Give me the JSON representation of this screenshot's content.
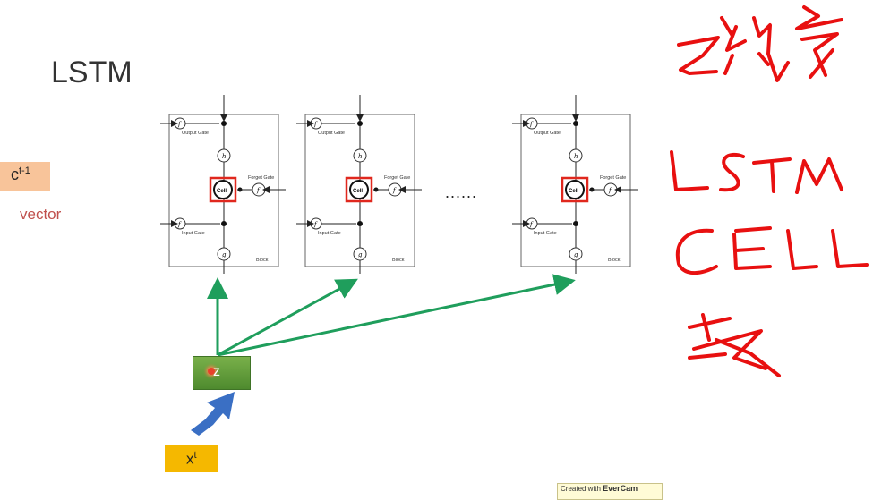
{
  "title": "LSTM",
  "inputs": {
    "ct_base": "c",
    "ct_sup": "t-1",
    "vector_label": "vector",
    "xt_base": "x",
    "xt_sup": "t",
    "z_label": "z"
  },
  "block_labels": {
    "output_gate": "Output Gate",
    "forget_gate": "Forget Gate",
    "input_gate": "Input Gate",
    "cell": "Cell",
    "block": "Block",
    "f": "f",
    "g": "g",
    "h": "h"
  },
  "ellipsis": "......",
  "handwriting_text": [
    "LSTM",
    "CELL"
  ],
  "watermark": {
    "created_with": "Created with",
    "brand": "EverCam"
  },
  "colors": {
    "arrow_green": "#1f9e5c",
    "highlight_red": "#e0281e",
    "handwriting_red": "#e81010",
    "input_arrow_blue": "#3a6fc4"
  }
}
